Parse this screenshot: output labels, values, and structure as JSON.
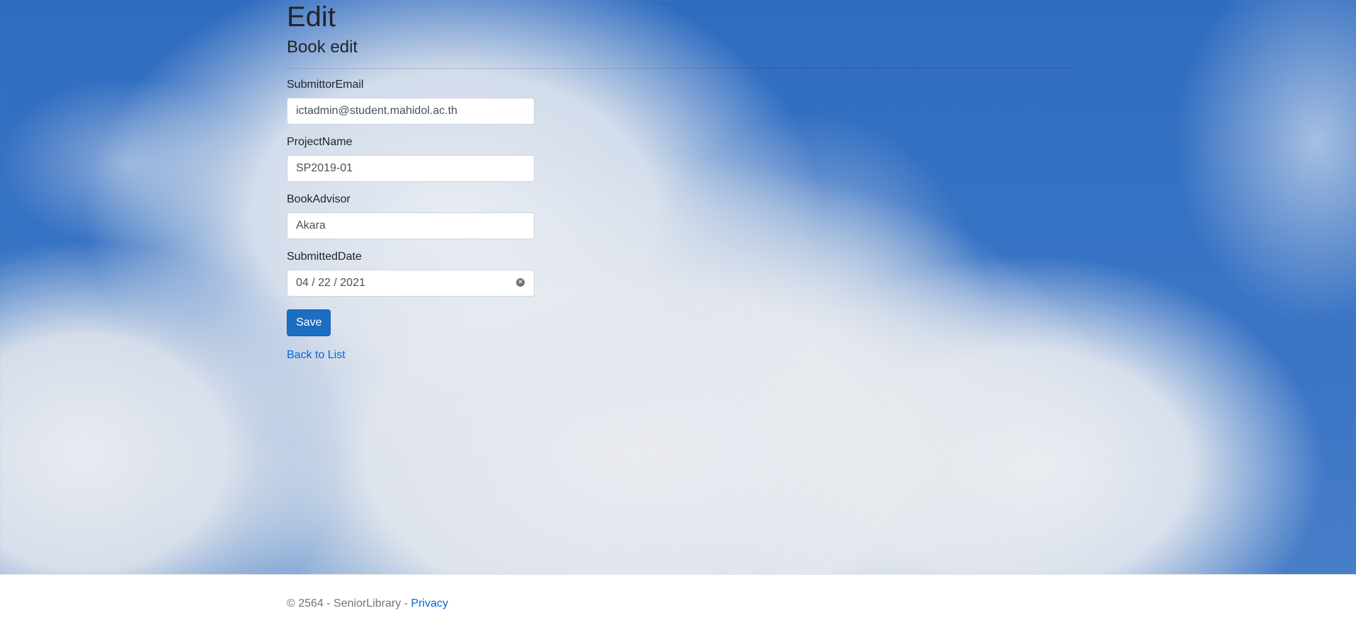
{
  "page": {
    "title": "Edit",
    "subtitle": "Book edit"
  },
  "form": {
    "fields": [
      {
        "label": "SubmittorEmail",
        "value": "ictadmin@student.mahidol.ac.th"
      },
      {
        "label": "ProjectName",
        "value": "SP2019-01"
      },
      {
        "label": "BookAdvisor",
        "value": "Akara"
      },
      {
        "label": "SubmittedDate",
        "value": "04 / 22 / 2021"
      }
    ],
    "clear_icon": "⊗",
    "save_label": "Save"
  },
  "links": {
    "back_to_list": "Back to List"
  },
  "footer": {
    "copyright": "© 2564 - SeniorLibrary - ",
    "privacy_label": "Privacy"
  },
  "colors": {
    "primary_button": "#1b6ec2",
    "link": "#0366d6"
  }
}
